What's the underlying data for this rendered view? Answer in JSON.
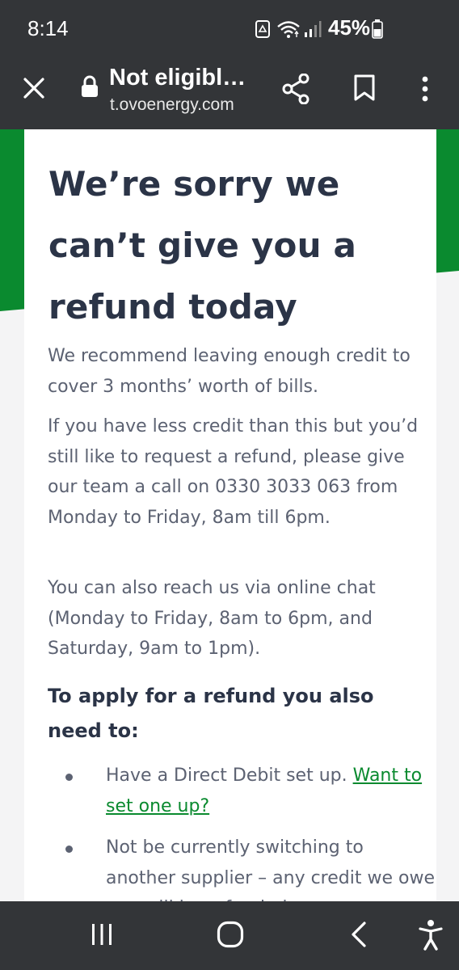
{
  "status_bar": {
    "time": "8:14",
    "battery": "45%",
    "icons": [
      "recycle-icon",
      "wifi-icon",
      "signal-icon",
      "battery-icon"
    ]
  },
  "browser": {
    "page_title": "Not eligibl…",
    "url": "t.ovoenergy.com",
    "icons": [
      "close-icon",
      "lock-icon",
      "share-icon",
      "bookmark-icon",
      "more-icon"
    ]
  },
  "content": {
    "heading": "We’re sorry we can’t give you a refund today",
    "paragraphs": [
      "We recommend leaving enough credit to cover 3 months’ worth of bills.",
      "If you have less credit than this but you’d still like to request a refund, please give our team a call on 0330 3033 063 from Monday to Friday, 8am till 6pm.",
      "You can also reach us via online chat (Monday to Friday, 8am to 6pm, and Saturday, 9am to 1pm)."
    ],
    "subheading": "To apply for a refund you also need to:",
    "requirements": [
      {
        "text": "Have a Direct Debit set up. ",
        "link": "Want to set one up?"
      },
      {
        "text": "Not be currently switching to another supplier – any credit we owe you will be refunded",
        "link": ""
      }
    ]
  },
  "nav_bar": {
    "icons": [
      "recent-apps-icon",
      "home-icon",
      "back-icon",
      "accessibility-icon"
    ]
  },
  "colors": {
    "system_bar": "#333538",
    "brand_green": "#0a8a2f",
    "heading_text": "#2b3447",
    "body_text": "#5c6272",
    "card_bg": "#ffffff",
    "page_bg": "#f4f4f5"
  }
}
